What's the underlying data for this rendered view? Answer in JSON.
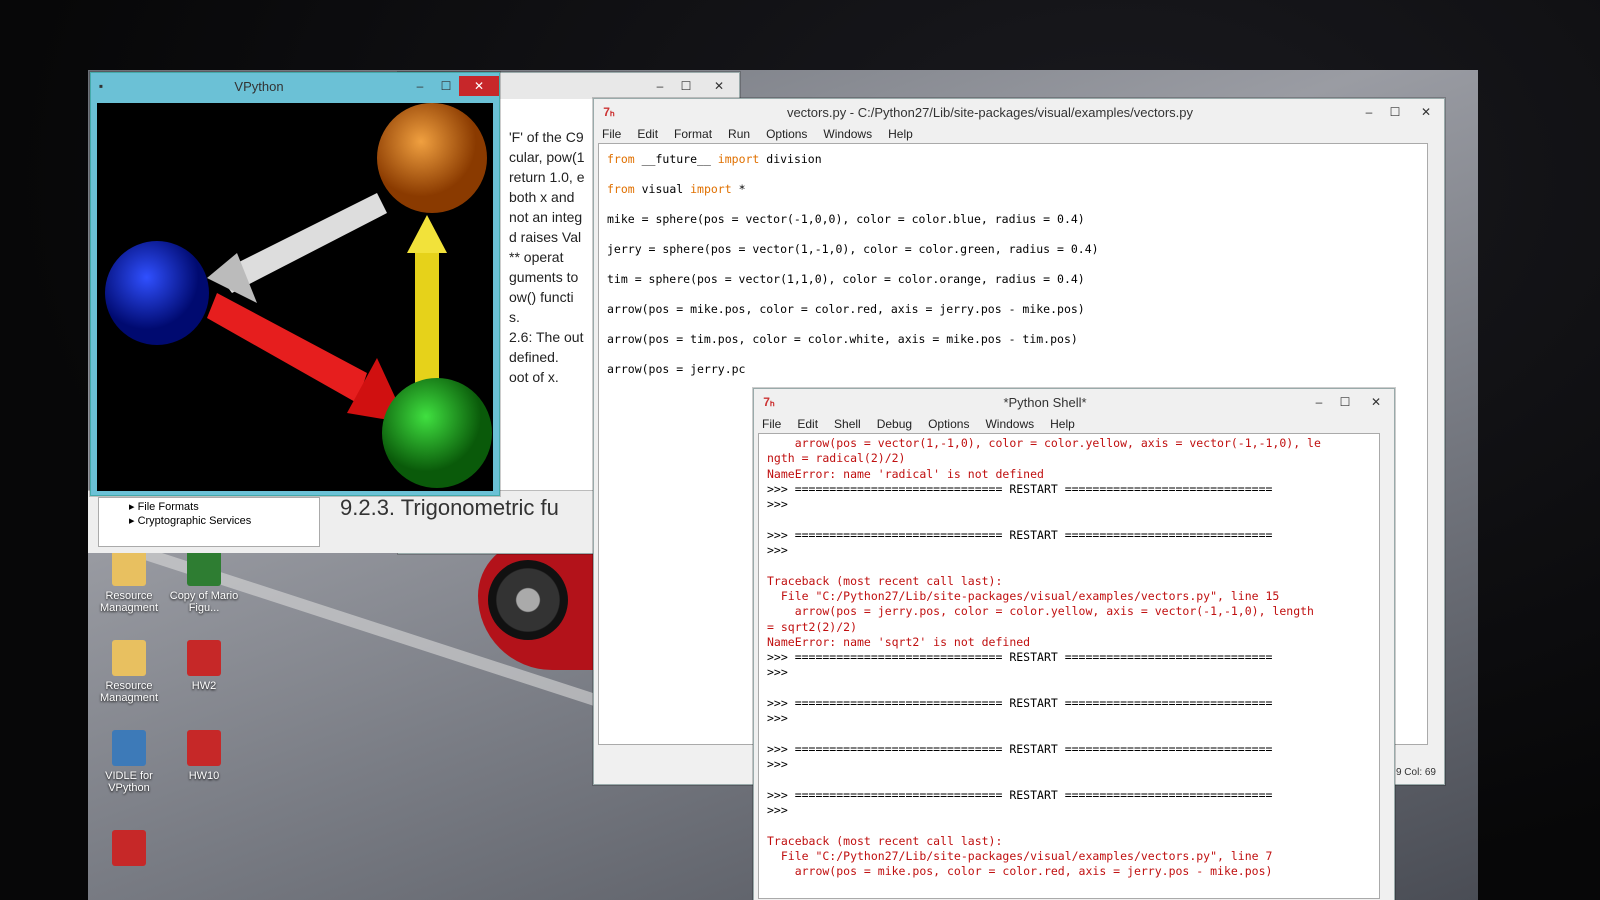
{
  "vpython": {
    "title": "VPython"
  },
  "doc_window": {
    "lines": [
      "'F' of the C9",
      "cular, pow(1",
      "return 1.0, e",
      "both x and",
      "not an integ",
      "d raises Val",
      "** operat",
      "guments to",
      "ow() functi",
      "s.",
      "2.6: The out",
      "defined.",
      "oot of x."
    ],
    "heading": "9.2.3. Trigonometric fu",
    "tree_items": [
      "File Formats",
      "Cryptographic Services"
    ]
  },
  "editor": {
    "title": "vectors.py - C:/Python27/Lib/site-packages/visual/examples/vectors.py",
    "menu": [
      "File",
      "Edit",
      "Format",
      "Run",
      "Options",
      "Windows",
      "Help"
    ],
    "status": "9 Col: 69",
    "lines": [
      {
        "kw1": "from",
        "mid": " __future__ ",
        "kw2": "import",
        "rest": " division"
      },
      {
        "kw1": "from",
        "mid": " visual ",
        "kw2": "import",
        "rest": " *"
      },
      {
        "kw1": "",
        "mid": "mike = sphere(pos = vector(-1,0,0), color = color.blue, radius = 0.4)",
        "kw2": "",
        "rest": ""
      },
      {
        "kw1": "",
        "mid": "jerry = sphere(pos = vector(1,-1,0), color = color.green, radius = 0.4)",
        "kw2": "",
        "rest": ""
      },
      {
        "kw1": "",
        "mid": "tim = sphere(pos = vector(1,1,0), color = color.orange, radius = 0.4)",
        "kw2": "",
        "rest": ""
      },
      {
        "kw1": "",
        "mid": "arrow(pos = mike.pos, color = color.red, axis = jerry.pos - mike.pos)",
        "kw2": "",
        "rest": ""
      },
      {
        "kw1": "",
        "mid": "",
        "kw2": "",
        "rest": ""
      },
      {
        "kw1": "",
        "mid": "arrow(pos = tim.pos, color = color.white, axis = mike.pos - tim.pos)",
        "kw2": "",
        "rest": ""
      },
      {
        "kw1": "",
        "mid": "",
        "kw2": "",
        "rest": ""
      },
      {
        "kw1": "",
        "mid": "arrow(pos = jerry.pc",
        "kw2": "",
        "rest": ""
      }
    ]
  },
  "shell": {
    "title": "*Python Shell*",
    "menu": [
      "File",
      "Edit",
      "Shell",
      "Debug",
      "Options",
      "Windows",
      "Help"
    ],
    "lines": [
      {
        "t": "    arrow(pos = vector(1,-1,0), color = color.yellow, axis = vector(-1,-1,0), le",
        "c": "err"
      },
      {
        "t": "ngth = radical(2)/2)",
        "c": "err"
      },
      {
        "t": "NameError: name 'radical' is not defined",
        "c": "err"
      },
      {
        "t": ">>> ============================== RESTART ==============================",
        "c": "out"
      },
      {
        "t": ">>>",
        "c": "out"
      },
      {
        "t": "",
        "c": "out"
      },
      {
        "t": ">>> ============================== RESTART ==============================",
        "c": "out"
      },
      {
        "t": ">>>",
        "c": "out"
      },
      {
        "t": "",
        "c": "out"
      },
      {
        "t": "Traceback (most recent call last):",
        "c": "err"
      },
      {
        "t": "  File \"C:/Python27/Lib/site-packages/visual/examples/vectors.py\", line 15",
        "c": "err"
      },
      {
        "t": "    arrow(pos = jerry.pos, color = color.yellow, axis = vector(-1,-1,0), length",
        "c": "err"
      },
      {
        "t": "= sqrt2(2)/2)",
        "c": "err"
      },
      {
        "t": "NameError: name 'sqrt2' is not defined",
        "c": "err"
      },
      {
        "t": ">>> ============================== RESTART ==============================",
        "c": "out"
      },
      {
        "t": ">>>",
        "c": "out"
      },
      {
        "t": "",
        "c": "out"
      },
      {
        "t": ">>> ============================== RESTART ==============================",
        "c": "out"
      },
      {
        "t": ">>>",
        "c": "out"
      },
      {
        "t": "",
        "c": "out"
      },
      {
        "t": ">>> ============================== RESTART ==============================",
        "c": "out"
      },
      {
        "t": ">>>",
        "c": "out"
      },
      {
        "t": "",
        "c": "out"
      },
      {
        "t": ">>> ============================== RESTART ==============================",
        "c": "out"
      },
      {
        "t": ">>>",
        "c": "out"
      },
      {
        "t": "",
        "c": "out"
      },
      {
        "t": "Traceback (most recent call last):",
        "c": "err"
      },
      {
        "t": "  File \"C:/Python27/Lib/site-packages/visual/examples/vectors.py\", line 7",
        "c": "err"
      },
      {
        "t": "    arrow(pos = mike.pos, color = color.red, axis = jerry.pos - mike.pos)",
        "c": "err"
      }
    ]
  },
  "desktop_icons": [
    {
      "label": "Resource Managment",
      "icon": "folder-icon",
      "color": "#e8c060"
    },
    {
      "label": "Copy of Mario Figu...",
      "icon": "excel-icon",
      "color": "#2e7d32"
    },
    {
      "label": "Resource Managment",
      "icon": "folder-icon",
      "color": "#e8c060"
    },
    {
      "label": "HW2",
      "icon": "pdf-icon",
      "color": "#c62828"
    },
    {
      "label": "VIDLE for VPython",
      "icon": "python-icon",
      "color": "#3d7ab8"
    },
    {
      "label": "HW10",
      "icon": "pdf-icon",
      "color": "#c62828"
    },
    {
      "label": "",
      "icon": "pdf-icon",
      "color": "#c62828"
    }
  ]
}
